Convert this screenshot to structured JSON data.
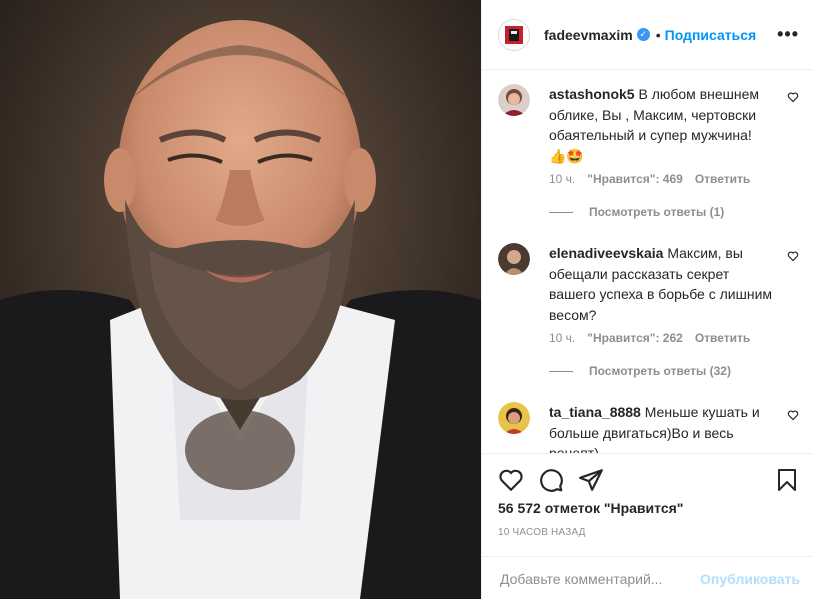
{
  "post": {
    "image_alt": "Portrait photo"
  },
  "header": {
    "username": "fadeevmaxim",
    "separator": "•",
    "follow_label": "Подписаться",
    "more_label": "•••",
    "verified_mark": "✓"
  },
  "comments": [
    {
      "username": "astashonok5",
      "text": "В любом внешнем облике, Вы , Максим, чертовски обаятельный и супер мужчина! 👍🤩",
      "time": "10 ч.",
      "likes": "\"Нравится\": 469",
      "reply_label": "Ответить",
      "replies_label": "Посмотреть ответы (1)"
    },
    {
      "username": "elenadiveevskaia",
      "text": "Максим, вы обещали рассказать секрет вашего успеха в борьбе с лишним весом?",
      "time": "10 ч.",
      "likes": "\"Нравится\": 262",
      "reply_label": "Ответить",
      "replies_label": "Посмотреть ответы (32)"
    },
    {
      "username": "ta_tiana_8888",
      "text": "Меньше кушать и больше двигаться)Во и весь рецепт)"
    }
  ],
  "stats": {
    "likes_text": "56 572 отметок \"Нравится\"",
    "posted_ago": "10 ЧАСОВ НАЗАД"
  },
  "add_comment": {
    "placeholder": "Добавьте комментарий...",
    "publish_label": "Опубликовать"
  },
  "colors": {
    "accent": "#0095f6",
    "publish_disabled": "#b2dffc",
    "muted": "#8e8e8e"
  }
}
